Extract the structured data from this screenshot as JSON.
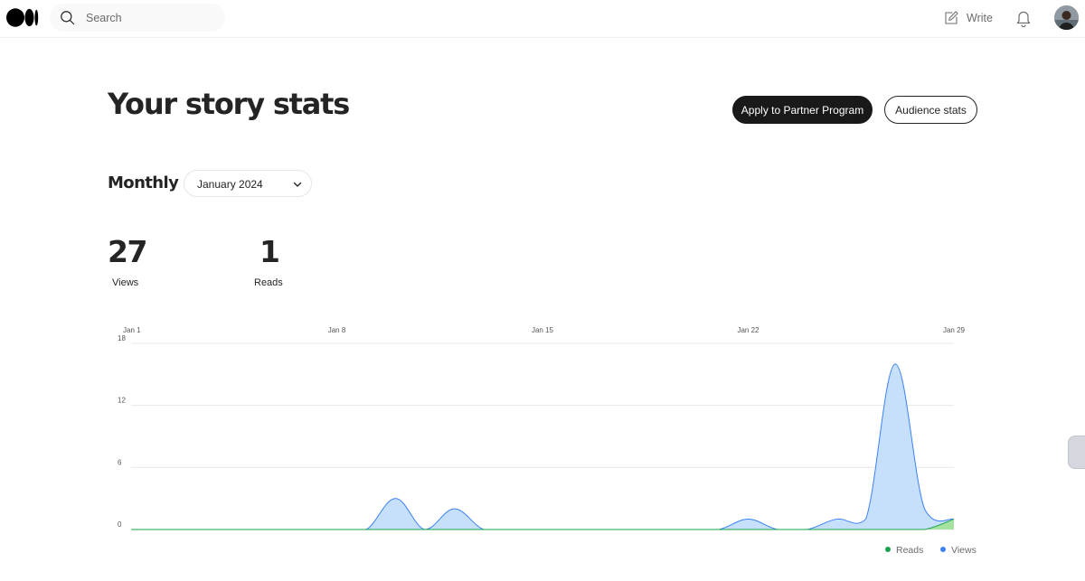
{
  "nav": {
    "search_placeholder": "Search",
    "write_label": "Write"
  },
  "header": {
    "title": "Your story stats",
    "partner_button": "Apply to Partner Program",
    "audience_button": "Audience stats"
  },
  "period": {
    "label": "Monthly",
    "selected_month": "January 2024"
  },
  "stats": {
    "views": {
      "value": "27",
      "label": "Views"
    },
    "reads": {
      "value": "1",
      "label": "Reads"
    }
  },
  "colors": {
    "views_stroke": "#3b82f6",
    "views_fill": "#c6e0fb",
    "reads_stroke": "#1aa34a",
    "reads_fill": "#a6e3a1",
    "primary_button": "#191919"
  },
  "chart_data": {
    "type": "area",
    "x_ticks": [
      "Jan 1",
      "Jan 8",
      "Jan 15",
      "Jan 22",
      "Jan 29"
    ],
    "y_ticks": [
      "0",
      "6",
      "12",
      "18"
    ],
    "ylim": [
      0,
      18
    ],
    "grid": true,
    "legend_position": "bottom-right",
    "categories": [
      "Jan 1",
      "Jan 2",
      "Jan 3",
      "Jan 4",
      "Jan 5",
      "Jan 6",
      "Jan 7",
      "Jan 8",
      "Jan 9",
      "Jan 10",
      "Jan 11",
      "Jan 12",
      "Jan 13",
      "Jan 14",
      "Jan 15",
      "Jan 16",
      "Jan 17",
      "Jan 18",
      "Jan 19",
      "Jan 20",
      "Jan 21",
      "Jan 22",
      "Jan 23",
      "Jan 24",
      "Jan 25",
      "Jan 26",
      "Jan 27",
      "Jan 28",
      "Jan 29"
    ],
    "series": [
      {
        "name": "Reads",
        "values": [
          0,
          0,
          0,
          0,
          0,
          0,
          0,
          0,
          0,
          0,
          0,
          0,
          0,
          0,
          0,
          0,
          0,
          0,
          0,
          0,
          0,
          0,
          0,
          0,
          0,
          0,
          0,
          0,
          1
        ]
      },
      {
        "name": "Views",
        "values": [
          0,
          0,
          0,
          0,
          0,
          0,
          0,
          0,
          0,
          3,
          0,
          2,
          0,
          0,
          0,
          0,
          0,
          0,
          0,
          0,
          0,
          1,
          0,
          0,
          1,
          1,
          16,
          2,
          1
        ]
      }
    ]
  }
}
